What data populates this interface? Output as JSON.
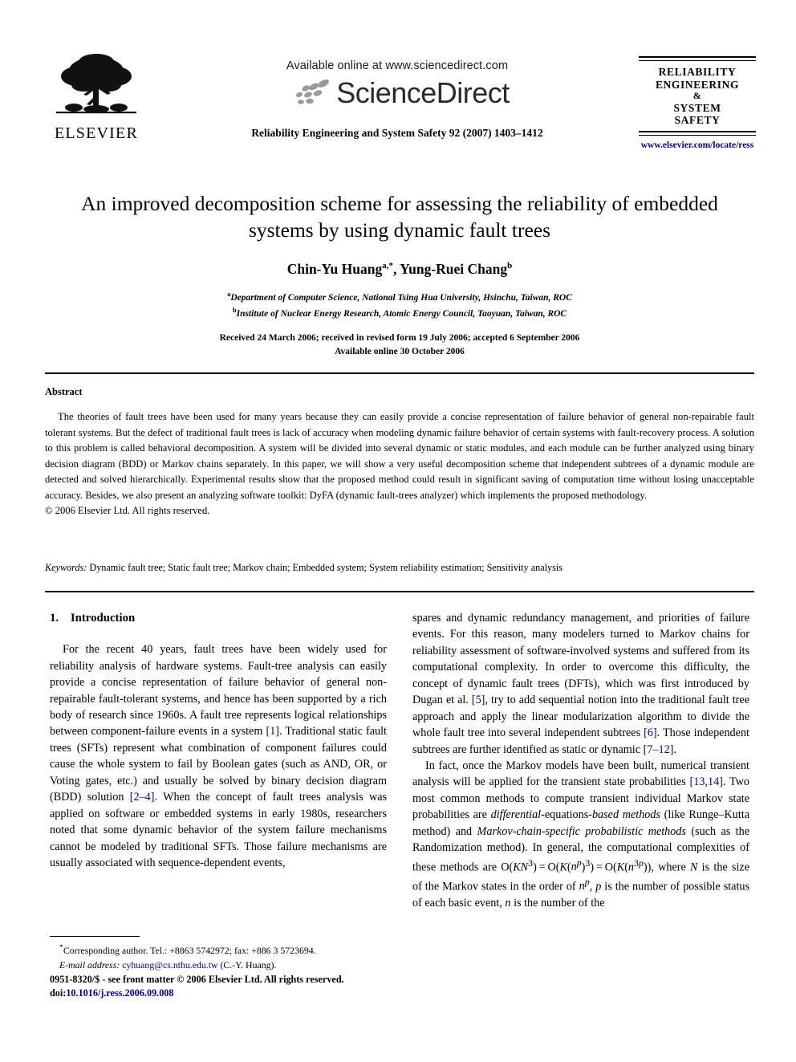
{
  "masthead": {
    "publisher_name": "ELSEVIER",
    "available_online": "Available online at www.sciencedirect.com",
    "sciencedirect_wordmark": "ScienceDirect",
    "journal_citation": "Reliability Engineering and System Safety 92 (2007) 1403–1412",
    "journal_box": {
      "line1": "RELIABILITY",
      "line2": "ENGINEERING",
      "line3": "&",
      "line4": "SYSTEM",
      "line5": "SAFETY"
    },
    "journal_url": "www.elsevier.com/locate/ress"
  },
  "article": {
    "title": "An improved decomposition scheme for assessing the reliability of embedded systems by using dynamic fault trees",
    "authors_html": "Chin-Yu Huang<sup>a,*</sup>, Yung-Ruei Chang<sup>b</sup>",
    "affiliation_a": "Department of Computer Science, National Tsing Hua University, Hsinchu, Taiwan, ROC",
    "affiliation_b": "Institute of Nuclear Energy Research, Atomic Energy Council, Taoyuan, Taiwan, ROC",
    "received_line": "Received 24 March 2006; received in revised form 19 July 2006; accepted 6 September 2006",
    "available_line": "Available online 30 October 2006"
  },
  "abstract": {
    "heading": "Abstract",
    "body": "The theories of fault trees have been used for many years because they can easily provide a concise representation of failure behavior of general non-repairable fault tolerant systems. But the defect of traditional fault trees is lack of accuracy when modeling dynamic failure behavior of certain systems with fault-recovery process. A solution to this problem is called behavioral decomposition. A system will be divided into several dynamic or static modules, and each module can be further analyzed using binary decision diagram (BDD) or Markov chains separately. In this paper, we will show a very useful decomposition scheme that independent subtrees of a dynamic module are detected and solved hierarchically. Experimental results show that the proposed method could result in significant saving of computation time without losing unacceptable accuracy. Besides, we also present an analyzing software toolkit: DyFA (dynamic fault-trees analyzer) which implements the proposed methodology.",
    "copyright": "© 2006 Elsevier Ltd. All rights reserved."
  },
  "keywords": {
    "label": "Keywords:",
    "text": " Dynamic fault tree; Static fault tree; Markov chain; Embedded system; System reliability estimation; Sensitivity analysis"
  },
  "body": {
    "section_heading": "1. Introduction",
    "left_p1_html": "For the recent 40 years, fault trees have been widely used for reliability analysis of hardware systems. Fault-tree analysis can easily provide a concise representation of failure behavior of general non-repairable fault-tolerant systems, and hence has been supported by a rich body of research since 1960s. A fault tree represents logical relationships between component-failure events in a system <span class=\"ref\">[1]</span>. Traditional static fault trees (SFTs) represent what combination of component failures could cause the whole system to fail by Boolean gates (such as AND, OR, or Voting gates, etc.) and usually be solved by binary decision diagram (BDD) solution <span class=\"ref\">[2–4]</span>. When the concept of fault trees analysis was applied on software or embedded systems in early 1980s, researchers noted that some dynamic behavior of the system failure mechanisms cannot be modeled by traditional SFTs. Those failure mechanisms are usually associated with sequence-dependent events,",
    "right_p1_html": "spares and dynamic redundancy management, and priorities of failure events. For this reason, many modelers turned to Markov chains for reliability assessment of software-involved systems and suffered from its computational complexity. In order to overcome this difficulty, the concept of dynamic fault trees (DFTs), which was first introduced by Dugan et al. <span class=\"ref\">[5]</span>, try to add sequential notion into the traditional fault tree approach and apply the linear modularization algorithm to divide the whole fault tree into several independent subtrees <span class=\"ref\">[6]</span>. Those independent subtrees are further identified as static or dynamic <span class=\"ref\">[7–12]</span>.",
    "right_p2_html": "In fact, once the Markov models have been built, numerical transient analysis will be applied for the transient state probabilities <span class=\"ref\">[13,14]</span>. Two most common methods to compute transient individual Markov state probabilities are <i>differential</i>-equations-<i>based methods</i> (like Runge–Kutta method) and <i>Markov-chain-specific probabilistic methods</i> (such as the Randomization method). In general, the computational complexities of these methods are O(<i>KN</i><sup>3</sup>) = O(<i>K</i>(<i>n<sup>p</sup></i>)<sup>3</sup>) = O(<i>K</i>(<i>n</i><sup>3<i>p</i></sup>)), where <i>N</i> is the size of the Markov states in the order of <i>n<sup>p</sup></i>, <i>p</i> is the number of possible status of each basic event, <i>n</i> is the number of the"
  },
  "footnote": {
    "corresponding_html": "<sup>*</sup>Corresponding author. Tel.: +8863 5742972; fax: +886 3 5723694.",
    "email_label": "E-mail address:",
    "email_value": "cyhuang@cs.nthu.edu.tw",
    "email_suffix": " (C.-Y. Huang)."
  },
  "imprint": {
    "front_matter": "0951-8320/$ - see front matter © 2006 Elsevier Ltd. All rights reserved.",
    "doi_label": "doi:",
    "doi_value": "10.1016/j.ress.2006.09.008"
  },
  "colors": {
    "link": "#00009b",
    "text": "#000000",
    "paper": "#ffffff"
  }
}
